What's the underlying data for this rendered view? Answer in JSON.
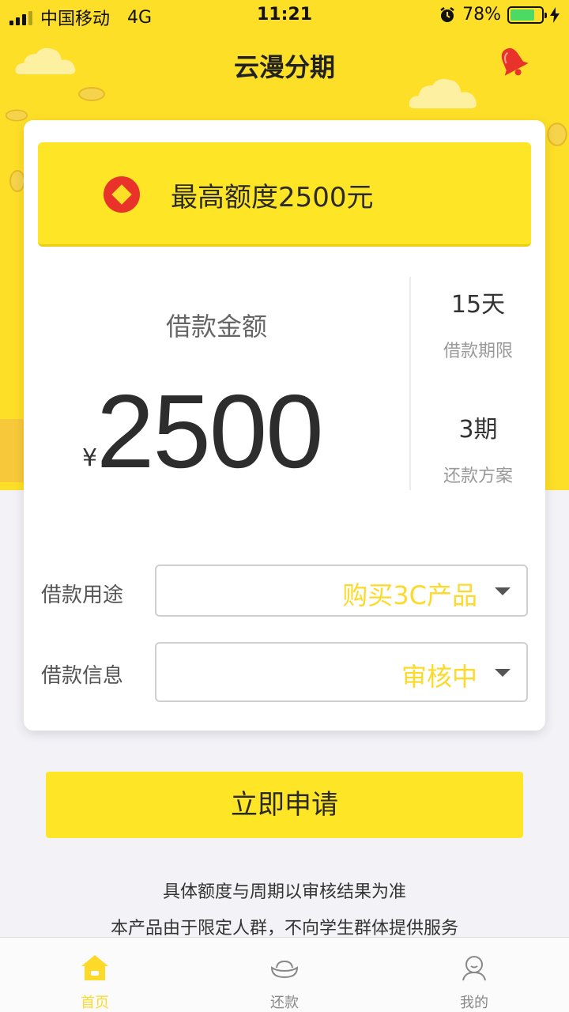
{
  "status_bar": {
    "carrier": "中国移动",
    "network": "4G",
    "time": "11:21",
    "battery_percent": "78%",
    "battery_level": 0.78,
    "icons": [
      "signal-icon",
      "alarm-icon",
      "battery-icon",
      "charging-icon"
    ]
  },
  "header": {
    "title": "云漫分期",
    "bell_icon": "bell-icon"
  },
  "quota_banner": {
    "text": "最高额度2500元",
    "icon": "diamond-badge-icon"
  },
  "loan": {
    "amount_label": "借款金额",
    "currency": "¥",
    "amount": "2500",
    "term_value": "15天",
    "term_label": "借款期限",
    "plan_value": "3期",
    "plan_label": "还款方案"
  },
  "form": {
    "purpose_label": "借款用途",
    "purpose_value": "购买3C产品",
    "info_label": "借款信息",
    "info_value": "审核中"
  },
  "apply_button": "立即申请",
  "notes": [
    "具体额度与周期以审核结果为准",
    "本产品由于限定人群，不向学生群体提供服务"
  ],
  "tabs": [
    {
      "label": "首页",
      "icon": "home-icon",
      "active": true
    },
    {
      "label": "还款",
      "icon": "ingot-icon",
      "active": false
    },
    {
      "label": "我的",
      "icon": "profile-icon",
      "active": false
    }
  ],
  "colors": {
    "brand_yellow": "#fedf27",
    "banner_yellow": "#fee526",
    "select_value_yellow": "#fdd92a",
    "badge_red": "#e8322a",
    "page_bg": "#f3f2f7"
  }
}
